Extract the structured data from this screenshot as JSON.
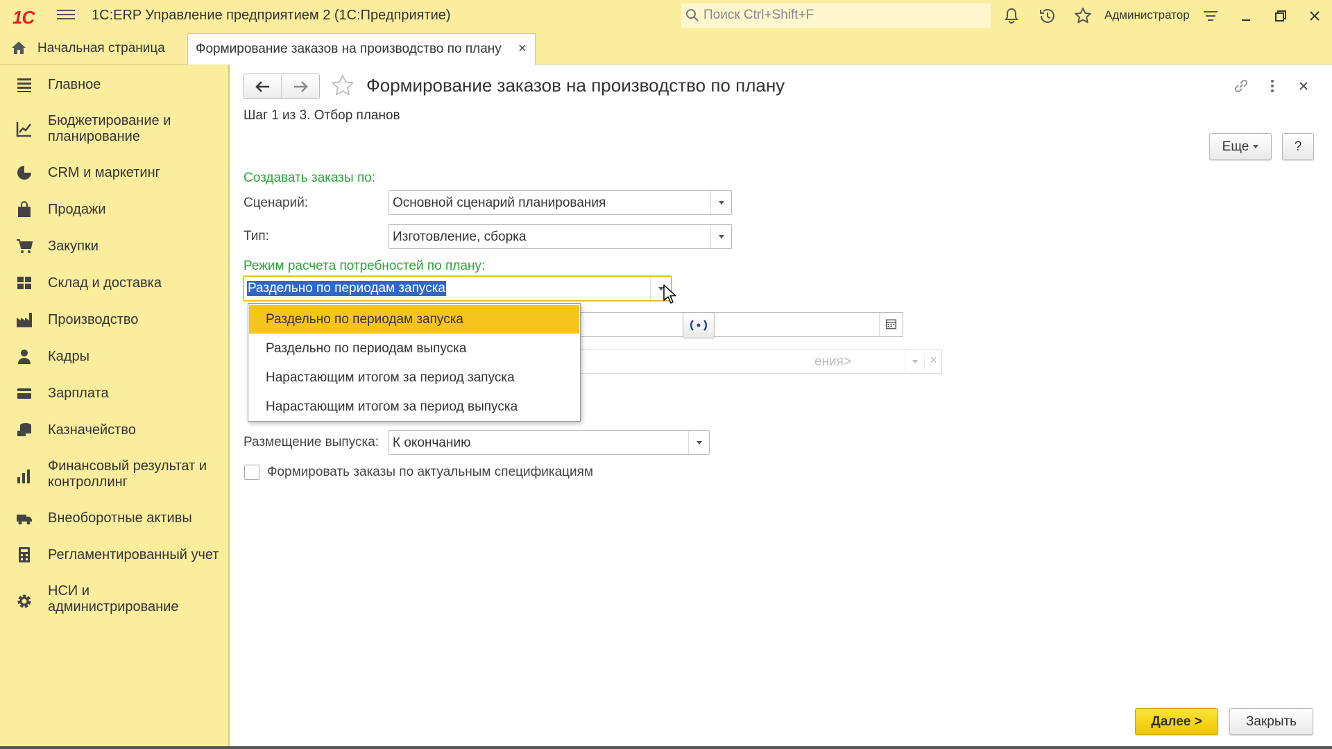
{
  "titlebar": {
    "logo": "1С",
    "app_title": "1С:ERP Управление предприятием 2  (1С:Предприятие)",
    "search_placeholder": "Поиск Ctrl+Shift+F",
    "user": "Администратор"
  },
  "tabs": {
    "home": "Начальная страница",
    "active": "Формирование заказов на производство по плану",
    "close_glyph": "×"
  },
  "sidebar": {
    "items": [
      {
        "label": "Главное",
        "icon": "menu-lines-icon"
      },
      {
        "label": "Бюджетирование и планирование",
        "icon": "budget-chart-icon"
      },
      {
        "label": "CRM и маркетинг",
        "icon": "pie-chart-icon"
      },
      {
        "label": "Продажи",
        "icon": "shopping-bag-icon"
      },
      {
        "label": "Закупки",
        "icon": "cart-icon"
      },
      {
        "label": "Склад и доставка",
        "icon": "warehouse-grid-icon"
      },
      {
        "label": "Производство",
        "icon": "factory-icon"
      },
      {
        "label": "Кадры",
        "icon": "person-icon"
      },
      {
        "label": "Зарплата",
        "icon": "wallet-icon"
      },
      {
        "label": "Казначейство",
        "icon": "coins-icon"
      },
      {
        "label": "Финансовый результат и контроллинг",
        "icon": "bar-chart-icon"
      },
      {
        "label": "Внеоборотные активы",
        "icon": "truck-icon"
      },
      {
        "label": "Регламентированный учет",
        "icon": "calculator-icon"
      },
      {
        "label": "НСИ и администрирование",
        "icon": "gear-icon"
      }
    ]
  },
  "page": {
    "title": "Формирование заказов на производство по плану",
    "step": "Шаг 1 из 3. Отбор планов",
    "more_button": "Еще",
    "help_button": "?",
    "create_orders_by": "Создавать заказы по:",
    "scenario_label": "Сценарий:",
    "scenario_value": "Основной сценарий планирования",
    "type_label": "Тип:",
    "type_value": "Изготовление, сборка",
    "calc_mode_label": "Режим расчета потребностей по плану:",
    "calc_mode_value": "Раздельно по периодам запуска",
    "period_button": "(•)",
    "hidden_combo_text": "ения>",
    "placement_label": "Размещение выпуска:",
    "placement_value": "К окончанию",
    "checkbox_label": "Формировать заказы по актуальным спецификациям",
    "next_button": "Далее >",
    "close_button": "Закрыть"
  },
  "dropdown": {
    "options": [
      "Раздельно по периодам запуска",
      "Раздельно по периодам выпуска",
      "Нарастающим итогом за период запуска",
      "Нарастающим итогом за период выпуска"
    ],
    "selected_index": 0
  },
  "colors": {
    "panel_yellow": "#fbed9e",
    "section_green": "#2aa336",
    "primary_button": "#f1c700",
    "selection_blue": "#3367c6",
    "dropdown_highlight": "#f5c51c"
  }
}
